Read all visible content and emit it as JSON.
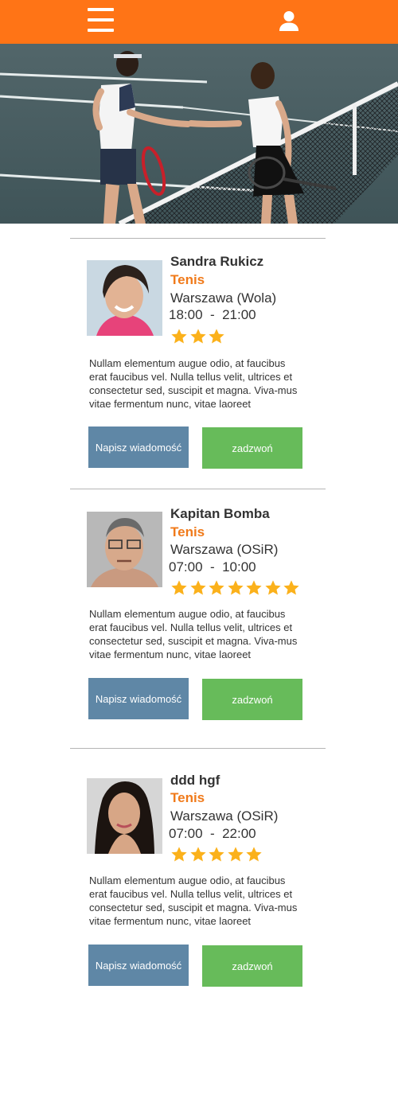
{
  "header": {
    "menu_icon": "hamburger-menu-icon",
    "user_icon": "user-icon",
    "background_color": "#ff7416"
  },
  "hero": {
    "image": "two tennis players shaking hands over the net"
  },
  "colors": {
    "accent": "#f07a1a",
    "message_button": "#5f87a6",
    "call_button": "#67bb5a",
    "star": "#fbb11b"
  },
  "profiles": [
    {
      "name": "Sandra Rukicz",
      "sport": "Tenis",
      "location": "Warszawa (Wola)",
      "hours": "18:00  -  21:00",
      "rating": 3,
      "description": "Nullam elementum augue odio, at faucibus erat faucibus vel. Nulla tellus velit, ultrices et consectetur sed, suscipit et magna. Viva-mus vitae fermentum nunc, vitae laoreet",
      "message_label": "Napisz wiadomość",
      "call_label": "zadzwoń"
    },
    {
      "name": "Kapitan Bomba",
      "sport": "Tenis",
      "location": "Warszawa (OSiR)",
      "hours": "07:00  -  10:00",
      "rating": 7,
      "description": "Nullam elementum augue odio, at faucibus erat faucibus vel. Nulla tellus velit, ultrices et consectetur sed, suscipit et magna. Viva-mus vitae fermentum nunc, vitae laoreet",
      "message_label": "Napisz wiadomość",
      "call_label": "zadzwoń"
    },
    {
      "name": "ddd hgf",
      "sport": "Tenis",
      "location": "Warszawa (OSiR)",
      "hours": "07:00  -  22:00",
      "rating": 5,
      "description": "Nullam elementum augue odio, at faucibus erat faucibus vel. Nulla tellus velit, ultrices et consectetur sed, suscipit et magna. Viva-mus vitae fermentum nunc, vitae laoreet",
      "message_label": "Napisz wiadomość",
      "call_label": "zadzwoń"
    }
  ]
}
